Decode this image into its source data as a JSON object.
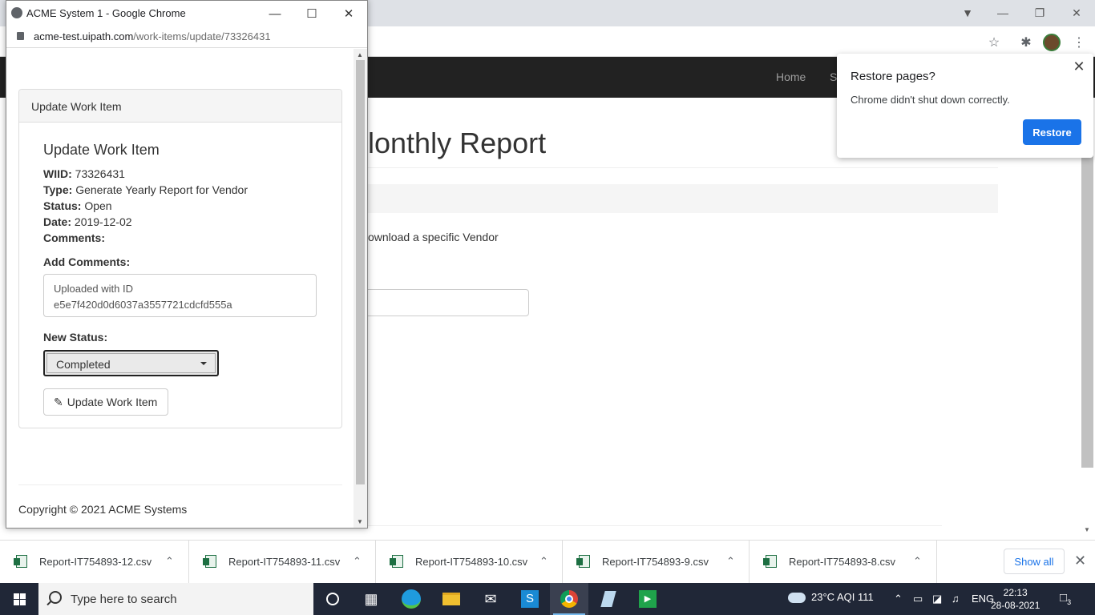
{
  "background_window": {
    "nav_links": [
      "Home",
      "S"
    ],
    "heading": "lonthly Report",
    "paragraph": "ownload a specific Vendor"
  },
  "restore_popup": {
    "title": "Restore pages?",
    "message": "Chrome didn't shut down correctly.",
    "restore_label": "Restore",
    "accent_color": "#1a73e8"
  },
  "popup_window": {
    "title": "ACME System 1 - Google Chrome",
    "url_host": "acme-test.uipath.com",
    "url_path": "/work-items/update/73326431",
    "panel_heading": "Update Work Item",
    "form_title": "Update Work Item",
    "wiid_label": "WIID:",
    "wiid_value": "73326431",
    "type_label": "Type:",
    "type_value": "Generate Yearly Report for Vendor",
    "status_label": "Status:",
    "status_value": "Open",
    "date_label": "Date:",
    "date_value": "2019-12-02",
    "comments_label": "Comments:",
    "add_comments_label": "Add Comments:",
    "comments_text": "Uploaded with ID e5e7f420d0d6037a3557721cdcfd555a",
    "new_status_label": "New Status:",
    "new_status_value": "Completed",
    "update_button_label": "Update Work Item",
    "copyright": "Copyright © 2021 ACME Systems"
  },
  "downloads": {
    "items": [
      "Report-IT754893-12.csv",
      "Report-IT754893-11.csv",
      "Report-IT754893-10.csv",
      "Report-IT754893-9.csv",
      "Report-IT754893-8.csv"
    ],
    "show_all_label": "Show all"
  },
  "taskbar": {
    "search_placeholder": "Type here to search",
    "weather": "23°C  AQI 111",
    "language": "ENG",
    "time": "22:13",
    "date": "28-08-2021",
    "notification_count": "3"
  }
}
